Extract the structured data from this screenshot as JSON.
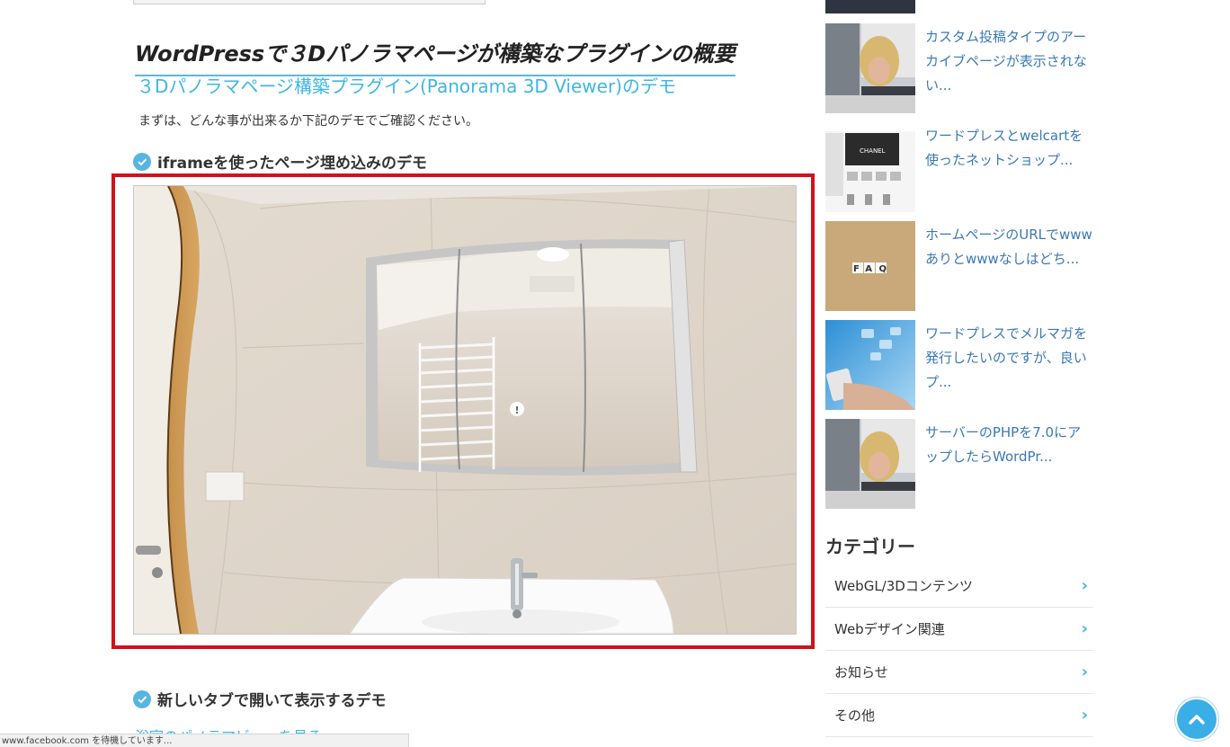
{
  "article": {
    "heading": "WordPressで３Dパノラマページが構築なプラグインの概要",
    "subheading": "３Dパノラマページ構築プラグイン(Panorama 3D Viewer)のデモ",
    "intro": "まずは、どんな事が出来るか下記のデモでご確認ください。",
    "iframe_heading": "iframeを使ったページ埋め込みのデモ",
    "newtab_heading": "新しいタブで開いて表示するデモ",
    "newtab_link": "浴室のパノラマビューを見る",
    "panorama_hotspot": "!"
  },
  "status_bar": "www.facebook.com を待機しています...",
  "sidebar": {
    "posts": [
      {
        "title": "カスタム投稿タイプのアーカイブページが表示されない..."
      },
      {
        "title": "ワードプレスとwelcartを使ったネットショップ..."
      },
      {
        "title": "ホームページのURLでwwwありとwwwなしはどち..."
      },
      {
        "title": "ワードプレスでメルマガを発行したいのですが、良いプ..."
      },
      {
        "title": "サーバーのPHPを7.0にアップしたらWordPr..."
      }
    ],
    "thumb_texts": {
      "chanel": "CHANEL",
      "faq": "FAQ"
    },
    "categories_heading": "カテゴリー",
    "categories": [
      {
        "label": "WebGL/3Dコンテンツ"
      },
      {
        "label": "Webデザイン関連"
      },
      {
        "label": "お知らせ"
      },
      {
        "label": "その他"
      }
    ]
  },
  "colors": {
    "accent": "#3fb6e2",
    "highlight_border": "#d0121b",
    "link": "#3a78b5"
  },
  "icons": {
    "check": "check-circle-icon",
    "chevron": "chevron-right-icon",
    "back_to_top": "chevron-up-icon"
  }
}
